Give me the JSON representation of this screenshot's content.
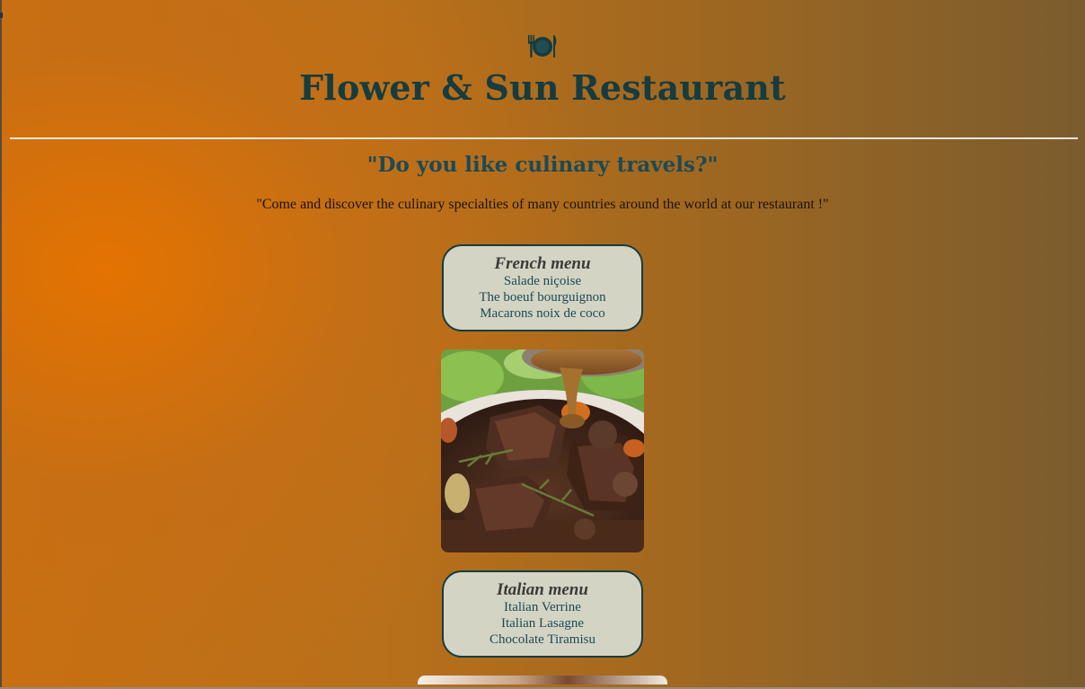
{
  "header": {
    "icon": "plate-cutlery-icon",
    "title": "Flower & Sun Restaurant"
  },
  "main": {
    "tagline": "\"Do you like culinary travels?\"",
    "intro": "\"Come and discover the culinary specialties of many countries around the world at our restaurant !\""
  },
  "menus": [
    {
      "title": "French menu",
      "items": [
        "Salade niçoise",
        "The boeuf bourguignon",
        "Macarons noix de coco"
      ]
    },
    {
      "title": "Italian menu",
      "items": [
        "Italian Verrine",
        "Italian Lasagne",
        "Chocolate Tiramisu"
      ]
    }
  ],
  "colors": {
    "heading": "#153c40",
    "card_background": "#d4d4c4",
    "background_orange": "#e67300",
    "background_brown": "#7b5c2e"
  }
}
